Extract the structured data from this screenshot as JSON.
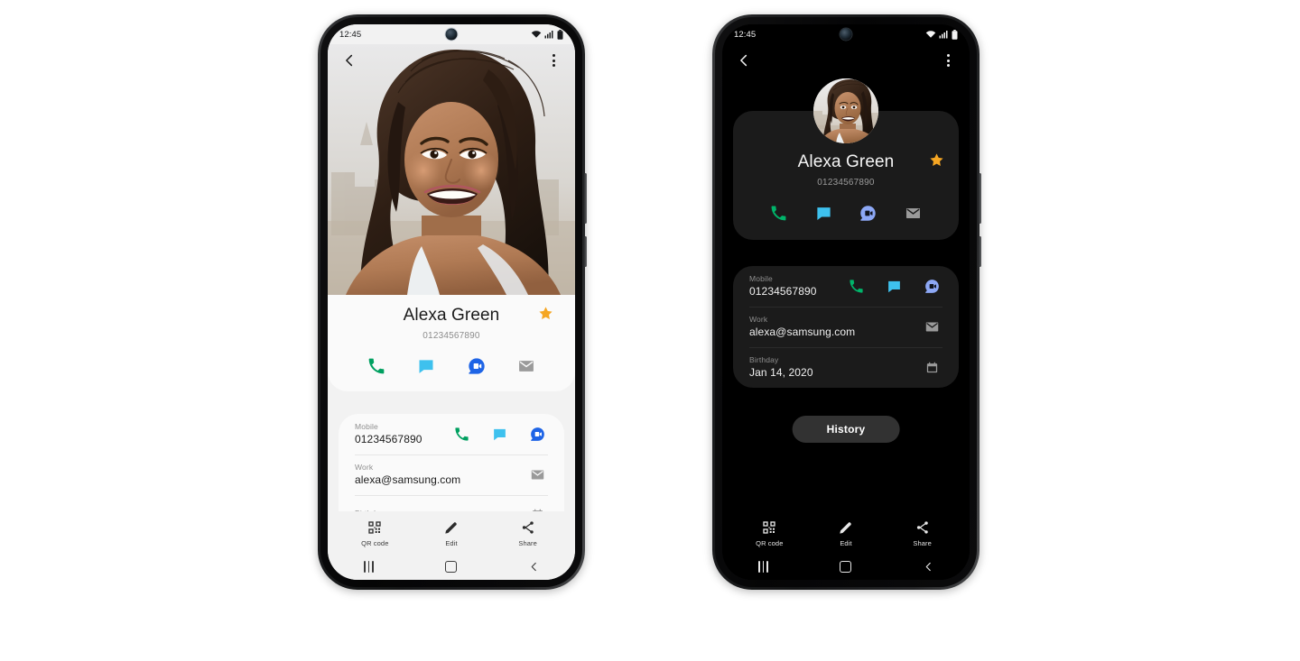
{
  "scene": {
    "background": "#ffffff",
    "accent_green": "#00a060",
    "accent_blue": "#3ec1ee",
    "accent_duo": "#1e64e6",
    "accent_duo_dark": "#8da8f5",
    "accent_star": "#f5a623",
    "mail_grey": "#9a9a9a"
  },
  "phones": [
    {
      "id": "light-phone",
      "theme": "light",
      "status_bar": {
        "time": "12:45",
        "icons": [
          "wifi-icon",
          "signal-icon",
          "battery-icon"
        ]
      },
      "appbar": {
        "back": "back-icon",
        "more": "more-options-icon"
      },
      "hero": {
        "type": "contact-photo",
        "alt": "Alexa Green portrait"
      },
      "contact": {
        "name": "Alexa Green",
        "number": "01234567890",
        "favorite": true,
        "actions": [
          {
            "name": "call",
            "icon": "phone-icon"
          },
          {
            "name": "message",
            "icon": "message-icon"
          },
          {
            "name": "video-call",
            "icon": "duo-video-icon"
          },
          {
            "name": "email",
            "icon": "mail-icon"
          }
        ]
      },
      "details": [
        {
          "label": "Mobile",
          "value": "01234567890",
          "icons": [
            {
              "name": "call",
              "icon": "phone-icon"
            },
            {
              "name": "message",
              "icon": "message-icon"
            },
            {
              "name": "video-call",
              "icon": "duo-video-icon"
            }
          ]
        },
        {
          "label": "Work",
          "value": "alexa@samsung.com",
          "icons": [
            {
              "name": "email",
              "icon": "mail-icon"
            }
          ]
        },
        {
          "label": "Birthday",
          "value": "",
          "icons": [
            {
              "name": "calendar",
              "icon": "calendar-icon"
            }
          ]
        }
      ],
      "history_button": null,
      "tools": [
        {
          "label": "QR code",
          "icon": "qr-code-icon"
        },
        {
          "label": "Edit",
          "icon": "pencil-icon"
        },
        {
          "label": "Share",
          "icon": "share-icon"
        }
      ],
      "nav": [
        {
          "name": "recents",
          "icon": "recents-icon"
        },
        {
          "name": "home",
          "icon": "home-icon"
        },
        {
          "name": "back",
          "icon": "back-nav-icon"
        }
      ]
    },
    {
      "id": "dark-phone",
      "theme": "dark",
      "status_bar": {
        "time": "12:45",
        "icons": [
          "wifi-icon",
          "signal-icon",
          "battery-icon"
        ]
      },
      "appbar": {
        "back": "back-icon",
        "more": "more-options-icon"
      },
      "hero": {
        "type": "avatar",
        "alt": "Alexa Green avatar"
      },
      "contact": {
        "name": "Alexa Green",
        "number": "01234567890",
        "favorite": true,
        "actions": [
          {
            "name": "call",
            "icon": "phone-icon"
          },
          {
            "name": "message",
            "icon": "message-icon"
          },
          {
            "name": "video-call",
            "icon": "duo-video-icon"
          },
          {
            "name": "email",
            "icon": "mail-icon"
          }
        ]
      },
      "details": [
        {
          "label": "Mobile",
          "value": "01234567890",
          "icons": [
            {
              "name": "call",
              "icon": "phone-icon"
            },
            {
              "name": "message",
              "icon": "message-icon"
            },
            {
              "name": "video-call",
              "icon": "duo-video-icon"
            }
          ]
        },
        {
          "label": "Work",
          "value": "alexa@samsung.com",
          "icons": [
            {
              "name": "email",
              "icon": "mail-icon"
            }
          ]
        },
        {
          "label": "Birthday",
          "value": "Jan 14, 2020",
          "icons": [
            {
              "name": "calendar",
              "icon": "calendar-icon"
            }
          ]
        }
      ],
      "history_button": "History",
      "tools": [
        {
          "label": "QR code",
          "icon": "qr-code-icon"
        },
        {
          "label": "Edit",
          "icon": "pencil-icon"
        },
        {
          "label": "Share",
          "icon": "share-icon"
        }
      ],
      "nav": [
        {
          "name": "recents",
          "icon": "recents-icon"
        },
        {
          "name": "home",
          "icon": "home-icon"
        },
        {
          "name": "back",
          "icon": "back-nav-icon"
        }
      ]
    }
  ]
}
